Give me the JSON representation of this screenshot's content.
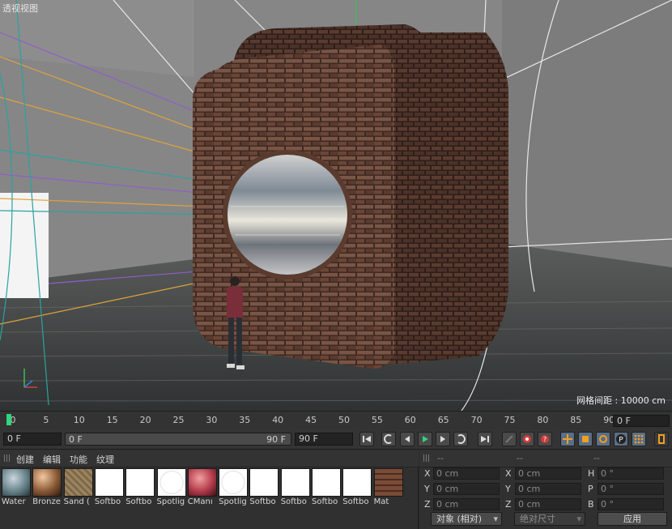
{
  "viewport": {
    "title": "透视视图",
    "grid_spacing": "网格间距 : 10000 cm"
  },
  "timeline": {
    "ticks": [
      "0",
      "5",
      "10",
      "15",
      "20",
      "25",
      "30",
      "35",
      "40",
      "45",
      "50",
      "55",
      "60",
      "65",
      "70",
      "75",
      "80",
      "85",
      "90"
    ],
    "current_frame": "0 F"
  },
  "transport": {
    "min_frame": "0 F",
    "range_start": "0 F",
    "range_end": "90 F",
    "max_frame": "90 F",
    "buttons": [
      "go-to-start",
      "prev-key",
      "prev-frame",
      "play",
      "next-frame",
      "next-key",
      "go-to-end",
      "record",
      "auto-key",
      "keyframe-selection",
      "move-key",
      "scale-key",
      "rotate-key",
      "point-level",
      "param-level",
      "dope-sheet",
      "timeline-window"
    ]
  },
  "materials": {
    "menu": [
      "创建",
      "编辑",
      "功能",
      "纹理"
    ],
    "items": [
      {
        "name": "Water",
        "icon": "water-material-icon"
      },
      {
        "name": "Bronze",
        "icon": "bronze-material-icon"
      },
      {
        "name": "Sand (",
        "icon": "sand-material-icon"
      },
      {
        "name": "Softbo",
        "icon": "softbox-material-icon"
      },
      {
        "name": "Softbo",
        "icon": "softbox-material-icon"
      },
      {
        "name": "Spotlig",
        "icon": "spotlight-material-icon"
      },
      {
        "name": "CManı",
        "icon": "cman-material-icon"
      },
      {
        "name": "Spotlig",
        "icon": "spotlight-material-icon"
      },
      {
        "name": "Softbo",
        "icon": "softbox-material-icon"
      },
      {
        "name": "Softbo",
        "icon": "softbox-material-icon"
      },
      {
        "name": "Softbo",
        "icon": "softbox-material-icon"
      },
      {
        "name": "Softbo",
        "icon": "softbox-material-icon"
      },
      {
        "name": "Mat",
        "icon": "brick-material-icon"
      }
    ]
  },
  "coordinates": {
    "header": [
      "--",
      "--",
      "--"
    ],
    "rows": [
      {
        "a_label": "X",
        "a_value": "0 cm",
        "b_label": "X",
        "b_value": "0 cm",
        "c_label": "H",
        "c_value": "0 °"
      },
      {
        "a_label": "Y",
        "a_value": "0 cm",
        "b_label": "Y",
        "b_value": "0 cm",
        "c_label": "P",
        "c_value": "0 °"
      },
      {
        "a_label": "Z",
        "a_value": "0 cm",
        "b_label": "Z",
        "b_value": "0 cm",
        "c_label": "B",
        "c_value": "0 °"
      }
    ],
    "mode_dropdown": "对象 (相对)",
    "size_dropdown": "绝对尺寸",
    "apply_label": "应用"
  }
}
